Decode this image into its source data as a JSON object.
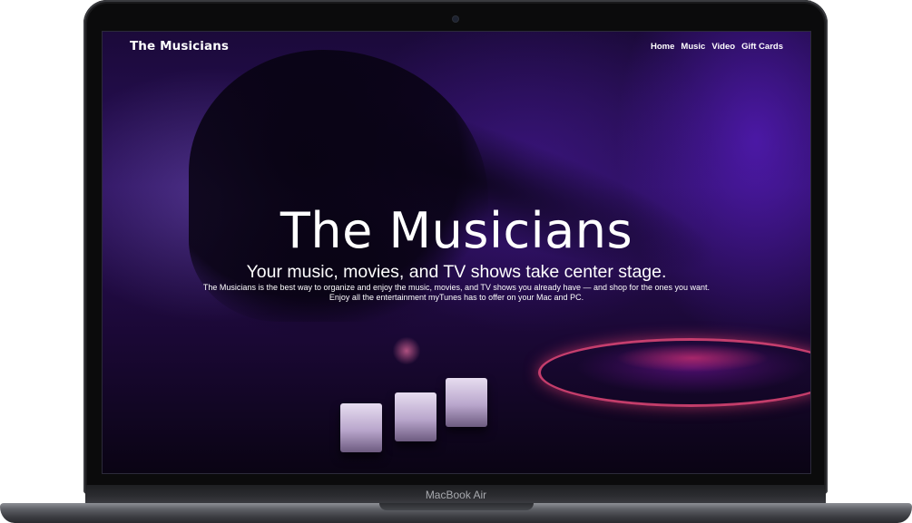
{
  "site": {
    "brand": "The Musicians",
    "nav": [
      {
        "label": "Home"
      },
      {
        "label": "Music"
      },
      {
        "label": "Video"
      },
      {
        "label": "Gift Cards"
      }
    ]
  },
  "hero": {
    "title": "The Musicians",
    "subtitle": "Your music, movies, and TV shows take center stage.",
    "description_line1": "The Musicians is the best way to organize and enjoy the music, movies, and TV shows you already have — and shop for the ones you want.",
    "description_line2": "Enjoy all the entertainment myTunes has to offer on your Mac and PC."
  },
  "device": {
    "model_label": "MacBook Air"
  },
  "colors": {
    "background_tint": "#2a0f5a",
    "accent_pink": "#ff4f82",
    "text": "#ffffff"
  }
}
